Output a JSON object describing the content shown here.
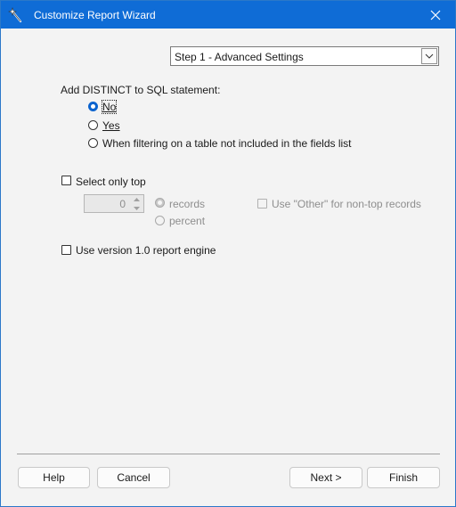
{
  "window": {
    "title": "Customize Report Wizard"
  },
  "step_select": {
    "value": "Step 1 - Advanced Settings"
  },
  "distinct": {
    "label": "Add DISTINCT to SQL statement:",
    "options": [
      {
        "label": "No",
        "checked": true
      },
      {
        "label": "Yes",
        "checked": false
      },
      {
        "label": "When filtering on a table not included in the fields list",
        "checked": false
      }
    ]
  },
  "top": {
    "checkbox_label": "Select only top",
    "value": "0",
    "unit_options": [
      {
        "label": "records",
        "checked": true
      },
      {
        "label": "percent",
        "checked": false
      }
    ],
    "other_label": "Use \"Other\" for non-top records"
  },
  "engine": {
    "label": "Use version 1.0 report engine"
  },
  "buttons": {
    "help": "Help",
    "cancel": "Cancel",
    "next": "Next >",
    "finish": "Finish"
  },
  "colors": {
    "titlebar": "#0f6cd6",
    "accent": "#0b63ce"
  }
}
